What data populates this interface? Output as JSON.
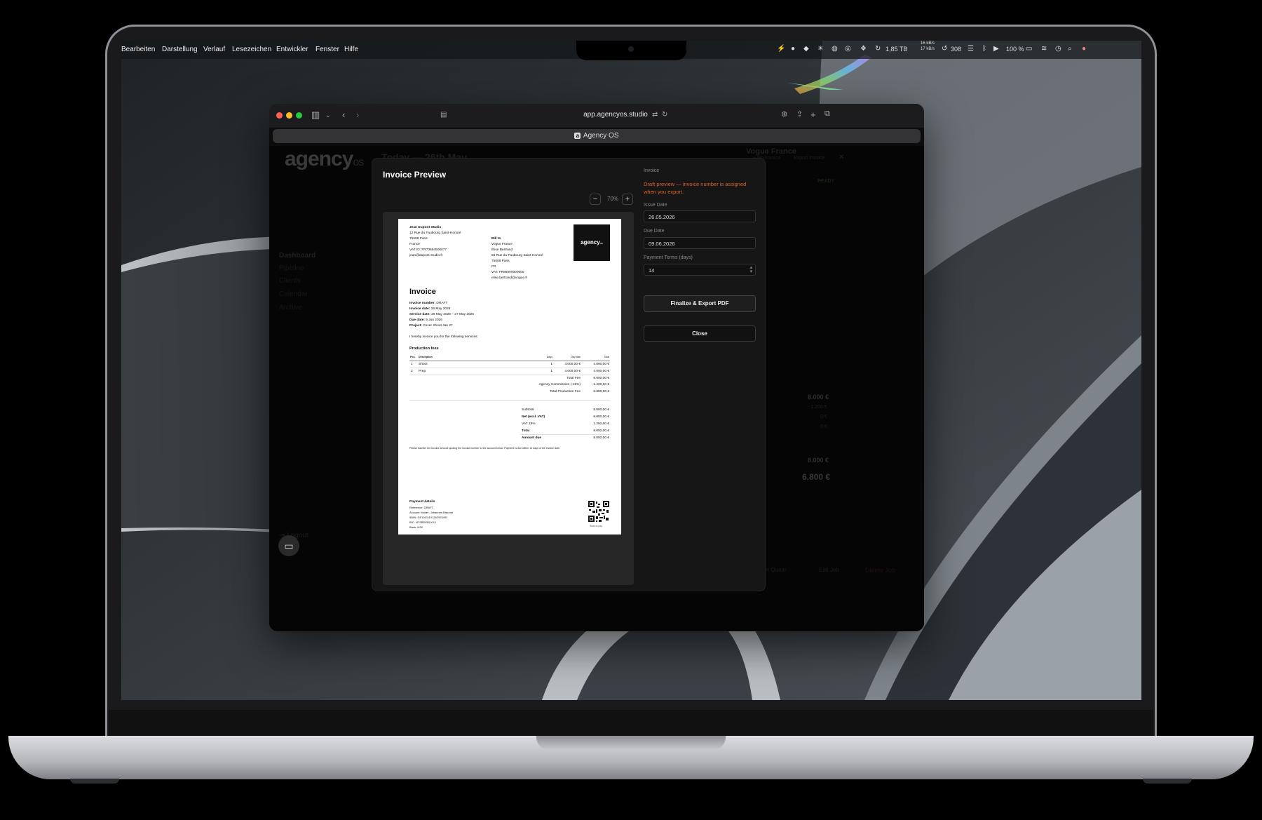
{
  "menubar": {
    "items": [
      "Bearbeiten",
      "Darstellung",
      "Verlauf",
      "Lesezeichen",
      "Entwickler",
      "Fenster",
      "Hilfe"
    ],
    "storage": "1,85 TB",
    "network_up": "16 kB/s",
    "network_down": "17 kB/s",
    "sync_count": "308",
    "battery": "100 %"
  },
  "browser": {
    "url": "app.agencyos.studio",
    "tab_title": "Agency OS",
    "tab_favicon": "a"
  },
  "app": {
    "logo_main": "agency",
    "logo_suffix": "os",
    "headline": "Today — 26th May",
    "client": "Vogue France",
    "no_invoice": "+ No Invoice",
    "export_invoice": "Export Invoice",
    "status": "READY",
    "nav": [
      "Dashboard",
      "Pipeline",
      "Clients",
      "Calendar",
      "Archive"
    ],
    "logout": "Logout",
    "totals": [
      "8.000 €",
      "- 1.200 €",
      "0 €",
      "0 €",
      "8.000 €",
      "6.800 €"
    ],
    "footer_buttons": [
      "Export Quote",
      "Edit Job",
      "Delete Job"
    ]
  },
  "modal": {
    "title": "Invoice Preview",
    "zoom": "70%",
    "side": {
      "section_label": "Invoice",
      "warning": "Draft preview — invoice number is assigned when you export.",
      "issue_date_label": "Issue Date",
      "issue_date": "26.05.2026",
      "due_date_label": "Due Date",
      "due_date": "09.06.2026",
      "payment_terms_label": "Payment Terms (days)",
      "payment_terms": "14",
      "finalize_label": "Finalize & Export PDF",
      "close_label": "Close"
    }
  },
  "invoice": {
    "sender": {
      "name": "Jean Dupont Studio",
      "street": "12 Rue du Faubourg Saint-Honoré",
      "city": "75008 Paris",
      "country": "France",
      "vat": "VAT ID: FR73664506077",
      "email": "jean@dupont-studio.fr"
    },
    "bill_to": {
      "label": "Bill to",
      "company": "Vogue France",
      "contact": "Élise Bertrand",
      "street": "56 Rue du Faubourg Saint-Honoré",
      "city": "75008 Paris",
      "country": "FR",
      "vat": "VAT: FR86000000000",
      "email": "elise.bertrand@vogue.fr"
    },
    "logo_text": "agency",
    "logo_suffix": "os",
    "heading": "Invoice",
    "meta": [
      {
        "label": "Invoice number:",
        "value": "DRAFT"
      },
      {
        "label": "Invoice date:",
        "value": "26 May 2026"
      },
      {
        "label": "Service date:",
        "value": "26 May 2026 – 27 May 2026"
      },
      {
        "label": "Due date:",
        "value": "9 Jun 2026"
      },
      {
        "label": "Project:",
        "value": "Cover Shoot Jan 27"
      }
    ],
    "intro": "I hereby invoice you for the following services:",
    "section": "Production fees",
    "columns": [
      "Pos.",
      "Description",
      "Days",
      "Day rate",
      "Total"
    ],
    "rows": [
      {
        "pos": "1",
        "desc": "Shoot",
        "days": "1",
        "rate": "4.000,00 €",
        "total": "4.000,00 €"
      },
      {
        "pos": "2",
        "desc": "Prep",
        "days": "1",
        "rate": "4.000,00 €",
        "total": "4.000,00 €"
      }
    ],
    "fee_lines": [
      {
        "label": "Total Fee",
        "value": "8.000,00 €"
      },
      {
        "label": "Agency Commission (-15%)",
        "value": "-1.200,00 €"
      },
      {
        "label": "Total Production Fee",
        "value": "6.800,00 €"
      }
    ],
    "summary": [
      {
        "label": "Subtotal",
        "value": "8.000,00 €"
      },
      {
        "label": "Net (excl. VAT)",
        "value": "6.800,00 €"
      },
      {
        "label": "VAT 19%",
        "value": "1.292,00 €"
      },
      {
        "label": "Total",
        "value": "8.092,00 €"
      },
      {
        "label": "Amount due",
        "value": "8.092,00 €"
      }
    ],
    "note": "Please transfer the invoice amount quoting the invoice number to the account below. Payment is due within 14 days of the invoice date.",
    "payment": {
      "heading": "Payment details",
      "reference": "Reference: DRAFT",
      "holder": "Account Holder: Johannes Brauner",
      "iban": "IBAN: DE11001101262976492",
      "bic": "BIC: NTSBDEB1XXX",
      "bank": "Bank: N26"
    },
    "qr_caption": "Scan to pay"
  }
}
